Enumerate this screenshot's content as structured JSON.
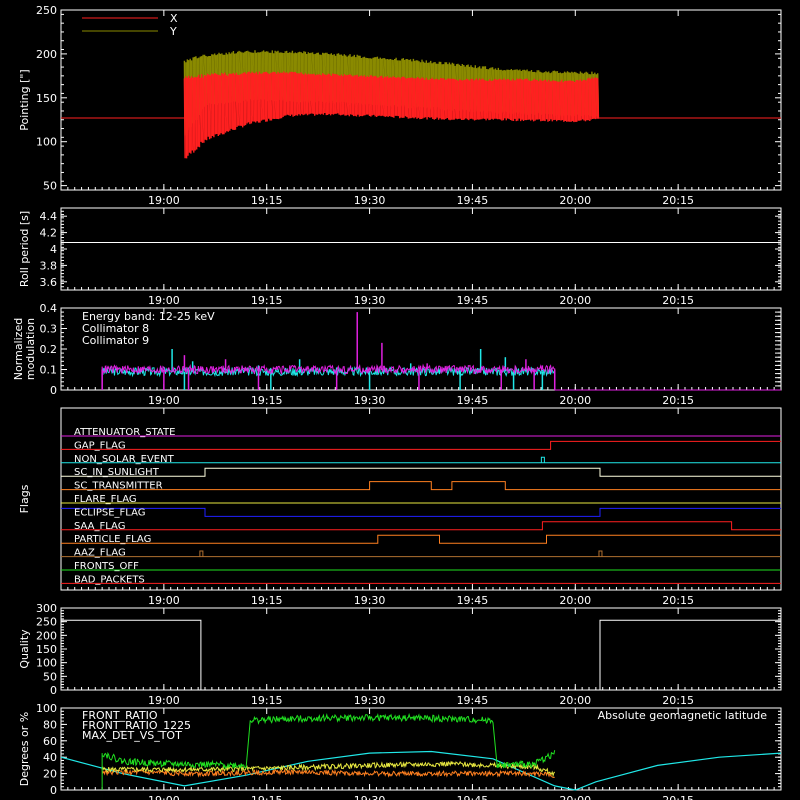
{
  "colors": {
    "background": "#000000",
    "axes": "#ffffff",
    "red": "#ff2020",
    "olive": "#8a8a00",
    "cyan": "#20e8e8",
    "magenta": "#e020e0",
    "green": "#20e020",
    "yellow": "#e8e840",
    "blue": "#2020ff",
    "orange": "#ff8020",
    "brown": "#b07030"
  },
  "time_axis": {
    "range_hours": [
      18.75,
      20.5
    ],
    "tick_hours": [
      19.0,
      19.25,
      19.5,
      19.75,
      20.0,
      20.25
    ],
    "tick_labels": [
      "19:00",
      "19:15",
      "19:30",
      "19:45",
      "20:00",
      "20:15"
    ]
  },
  "chart_data": [
    {
      "type": "area",
      "panel": "pointing",
      "ylabel": "Pointing [\"]",
      "ylim": [
        45,
        250
      ],
      "yticks": [
        50,
        100,
        150,
        200,
        250
      ],
      "legend": {
        "placement": "top-left"
      },
      "series": [
        {
          "name": "X",
          "color": "#ff2020",
          "flat": 127,
          "x": [
            19.05,
            19.1,
            19.2,
            19.3,
            19.4,
            19.5,
            19.6,
            19.7,
            19.8,
            19.9,
            20.0,
            20.055
          ],
          "low": [
            78,
            100,
            118,
            128,
            130,
            128,
            126,
            124,
            124,
            123,
            122,
            124
          ],
          "high": [
            175,
            178,
            180,
            180,
            178,
            176,
            174,
            172,
            172,
            172,
            170,
            175
          ]
        },
        {
          "name": "Y",
          "color": "#8a8a00",
          "flat": 127,
          "x": [
            19.05,
            19.1,
            19.2,
            19.3,
            19.4,
            19.5,
            19.6,
            19.7,
            19.8,
            19.9,
            20.0,
            20.055
          ],
          "low": [
            105,
            140,
            145,
            145,
            143,
            140,
            138,
            135,
            132,
            130,
            128,
            128
          ],
          "high": [
            195,
            200,
            205,
            204,
            202,
            198,
            195,
            190,
            185,
            182,
            180,
            180
          ]
        }
      ]
    },
    {
      "type": "line",
      "panel": "roll",
      "ylabel": "Roll period [s]",
      "ylim": [
        3.5,
        4.5
      ],
      "yticks": [
        3.6,
        3.8,
        4.0,
        4.2,
        4.4
      ],
      "series": [
        {
          "name": "",
          "color": "#ffffff",
          "x": [
            18.75,
            20.5
          ],
          "y": [
            4.08,
            4.08
          ]
        }
      ]
    },
    {
      "type": "line",
      "panel": "modulation",
      "ylabel": "Normalized modulation",
      "ylim": [
        0.0,
        0.4
      ],
      "yticks": [
        0.0,
        0.1,
        0.2,
        0.3,
        0.4
      ],
      "annotation": "Energy band: 12-25 keV",
      "legend": {
        "placement": "top-left"
      },
      "series": [
        {
          "name": "Collimator 8",
          "color": "#20e8e8",
          "active": [
            18.85,
            19.95
          ],
          "base": 0.09,
          "spikes": [
            [
              19.02,
              0.2
            ],
            [
              19.07,
              0.14
            ],
            [
              19.23,
              0.12
            ],
            [
              19.33,
              0.15
            ],
            [
              19.42,
              0.11
            ],
            [
              19.6,
              0.13
            ],
            [
              19.77,
              0.2
            ],
            [
              19.83,
              0.16
            ]
          ],
          "drops": [
            19.05,
            19.26,
            19.5,
            19.72,
            19.85,
            19.92
          ]
        },
        {
          "name": "Collimator 9",
          "color": "#e020e0",
          "active": [
            18.85,
            19.95
          ],
          "base": 0.1,
          "spikes": [
            [
              19.05,
              0.17
            ],
            [
              19.15,
              0.15
            ],
            [
              19.47,
              0.38
            ],
            [
              19.53,
              0.23
            ],
            [
              19.64,
              0.13
            ],
            [
              19.88,
              0.15
            ],
            [
              19.92,
              0.12
            ]
          ],
          "drops": [
            18.85,
            19.0,
            19.06,
            19.23,
            19.42,
            19.62,
            19.82,
            19.9,
            19.95
          ],
          "zero_after": 19.95
        }
      ]
    },
    {
      "type": "line",
      "panel": "flags",
      "ylabel": "Flags",
      "series": [
        {
          "name": "ATTENUATOR_STATE",
          "color": "#e020e0",
          "steps": [
            [
              18.75,
              0
            ]
          ]
        },
        {
          "name": "GAP_FLAG",
          "color": "#ff2020",
          "steps": [
            [
              18.75,
              0
            ],
            [
              19.94,
              1
            ]
          ]
        },
        {
          "name": "NON_SOLAR_EVENT",
          "color": "#20e8e8",
          "steps": [
            [
              18.75,
              0
            ]
          ],
          "pulses": [
            19.92
          ]
        },
        {
          "name": "SC_IN_SUNLIGHT",
          "color": "#ffffe0",
          "steps": [
            [
              18.75,
              0
            ],
            [
              19.1,
              1
            ],
            [
              20.06,
              0
            ]
          ]
        },
        {
          "name": "SC_TRANSMITTER",
          "color": "#ff8020",
          "steps": [
            [
              18.75,
              0
            ],
            [
              19.5,
              1
            ],
            [
              19.65,
              0
            ],
            [
              19.7,
              1
            ],
            [
              19.83,
              0
            ]
          ]
        },
        {
          "name": "FLARE_FLAG",
          "color": "#e8e840",
          "steps": [
            [
              18.75,
              0
            ]
          ]
        },
        {
          "name": "ECLIPSE_FLAG",
          "color": "#2020ff",
          "steps": [
            [
              18.75,
              1
            ],
            [
              19.1,
              0
            ],
            [
              20.06,
              1
            ]
          ]
        },
        {
          "name": "SAA_FLAG",
          "color": "#ff2020",
          "steps": [
            [
              18.75,
              0
            ],
            [
              19.92,
              1
            ],
            [
              20.38,
              0
            ]
          ]
        },
        {
          "name": "PARTICLE_FLAG",
          "color": "#ff8020",
          "steps": [
            [
              18.75,
              0
            ],
            [
              19.52,
              1
            ],
            [
              19.67,
              0
            ],
            [
              19.93,
              1
            ]
          ]
        },
        {
          "name": "AAZ_FLAG",
          "color": "#b07030",
          "steps": [
            [
              18.75,
              0
            ]
          ],
          "pulses": [
            19.09,
            20.06
          ]
        },
        {
          "name": "FRONTS_OFF",
          "color": "#20e020",
          "steps": [
            [
              18.75,
              0
            ]
          ]
        },
        {
          "name": "BAD_PACKETS",
          "color": "#ff2020",
          "steps": [
            [
              18.75,
              0
            ]
          ]
        }
      ]
    },
    {
      "type": "line",
      "panel": "quality",
      "ylabel": "Quality",
      "ylim": [
        0,
        300
      ],
      "yticks": [
        0,
        50,
        100,
        150,
        200,
        250,
        300
      ],
      "series": [
        {
          "name": "",
          "color": "#ffffff",
          "x": [
            18.75,
            19.09,
            19.09,
            20.06,
            20.06,
            20.5
          ],
          "y": [
            255,
            255,
            0,
            0,
            255,
            255
          ]
        }
      ]
    },
    {
      "type": "line",
      "panel": "latitude",
      "ylabel": "Degrees or %",
      "ylim": [
        0,
        100
      ],
      "yticks": [
        0,
        20,
        40,
        60,
        80,
        100
      ],
      "annotation": "Absolute geomagnetic latitude",
      "legend": {
        "placement": "top-left"
      },
      "series": [
        {
          "name": "FRONT_RATIO",
          "color": "#e8e840",
          "x": [
            18.85,
            19.1,
            19.3,
            19.5,
            19.7,
            19.9,
            19.95
          ],
          "y": [
            25,
            25,
            27,
            30,
            32,
            28,
            20
          ]
        },
        {
          "name": "FRONT_RATIO_1225",
          "color": "#20e020",
          "x": [
            18.85,
            18.9,
            19.0,
            19.2,
            19.21,
            19.4,
            19.6,
            19.8,
            19.81,
            19.9,
            19.95
          ],
          "y": [
            45,
            35,
            32,
            30,
            85,
            88,
            88,
            85,
            30,
            32,
            45
          ]
        },
        {
          "name": "MAX_DET_VS_TOT",
          "color": "#ff8020",
          "x": [
            18.85,
            19.1,
            19.3,
            19.5,
            19.7,
            19.9,
            19.95
          ],
          "y": [
            22,
            20,
            22,
            20,
            20,
            20,
            18
          ]
        },
        {
          "name": "Absolute geomagnetic latitude",
          "color": "#20e8e8",
          "x": [
            18.75,
            18.9,
            19.05,
            19.2,
            19.35,
            19.5,
            19.65,
            19.8,
            19.95,
            20.0,
            20.05,
            20.2,
            20.35,
            20.5
          ],
          "y": [
            40,
            20,
            5,
            18,
            35,
            45,
            47,
            38,
            5,
            0,
            10,
            30,
            40,
            45
          ]
        }
      ]
    }
  ]
}
